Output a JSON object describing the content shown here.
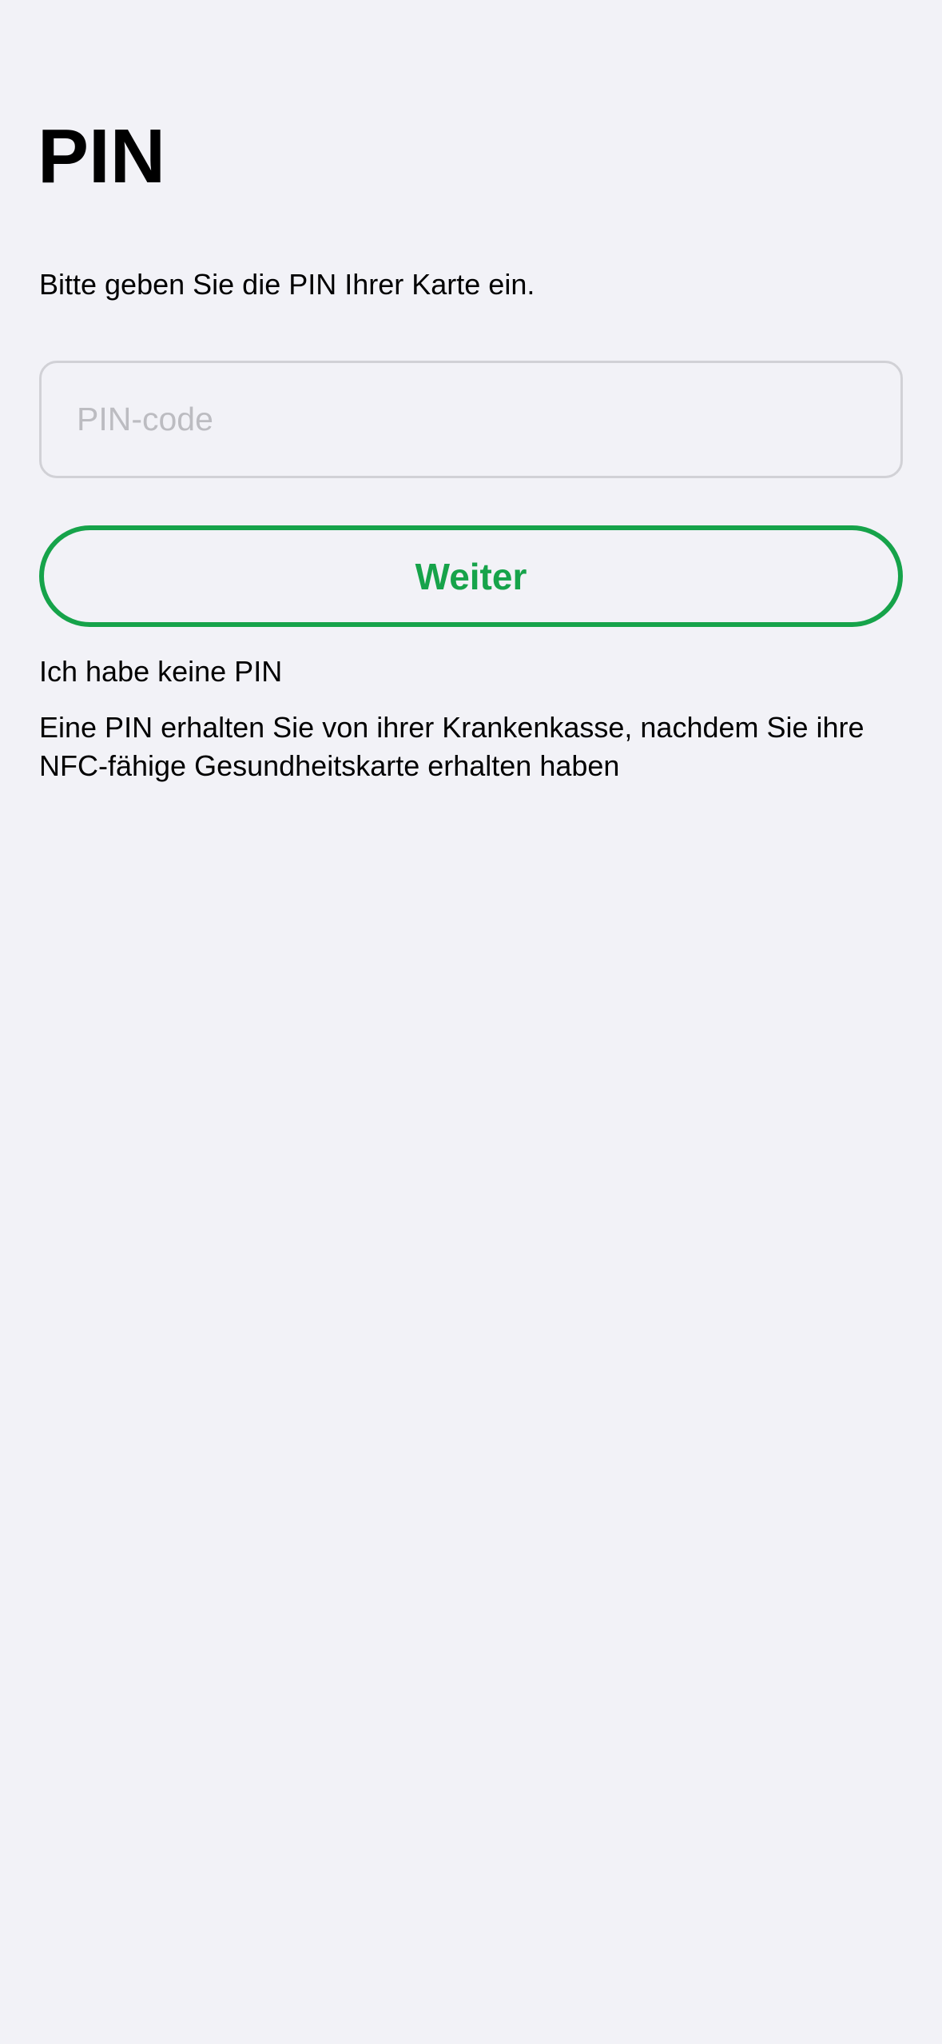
{
  "header": {
    "title": "PIN"
  },
  "main": {
    "instruction": "Bitte geben Sie die PIN Ihrer Karte ein.",
    "pin_input": {
      "value": "",
      "placeholder": "PIN-code"
    },
    "continue_label": "Weiter",
    "no_pin_link": "Ich habe keine PIN",
    "no_pin_info": "Eine PIN erhalten Sie von ihrer Krankenkasse, nachdem Sie ihre NFC-fähige Gesundheitskarte erhalten haben"
  },
  "colors": {
    "background": "#f2f2f7",
    "accent": "#16a34a",
    "field_border": "#d1d1d6",
    "placeholder": "#bcbcc1"
  }
}
